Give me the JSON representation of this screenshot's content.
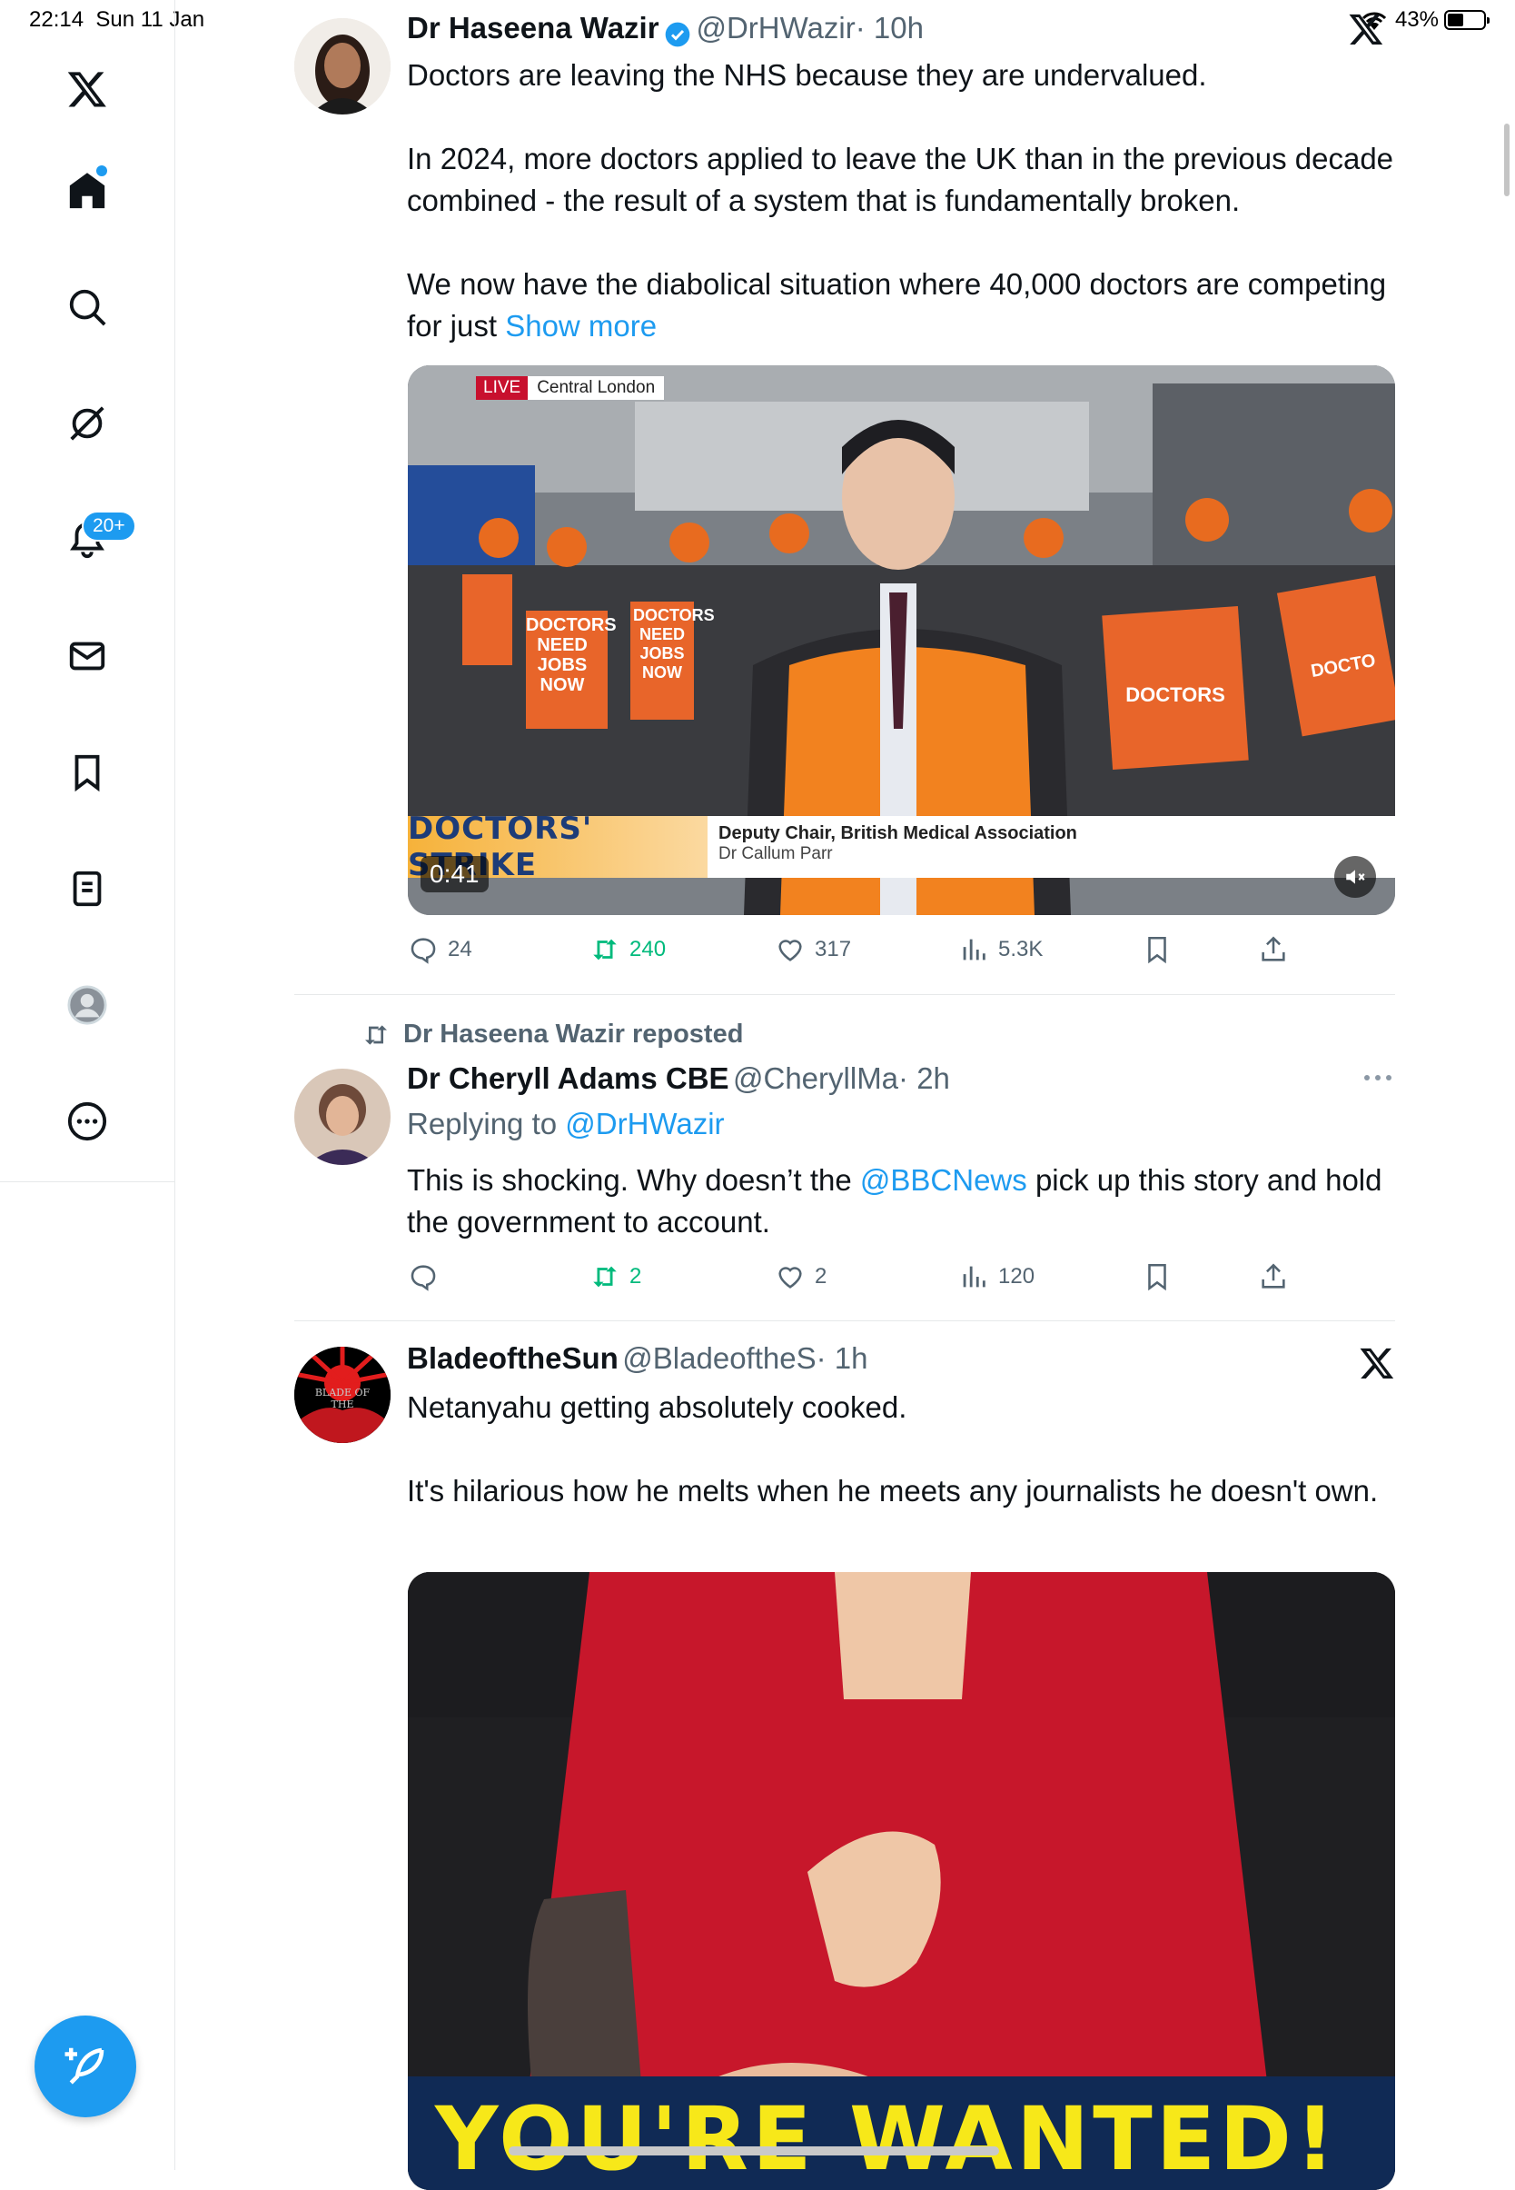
{
  "status_bar": {
    "time": "22:14",
    "date": "Sun 11 Jan",
    "battery": "43%"
  },
  "sidebar": {
    "notifications_badge": "20+",
    "items": [
      "x-logo",
      "home",
      "search",
      "grok",
      "notifications",
      "messages",
      "bookmarks",
      "lists",
      "profile",
      "more"
    ]
  },
  "tweet1": {
    "name": "Dr Haseena Wazir",
    "handle": "@DrHWazir",
    "time": "· 10h",
    "p1": "Doctors are leaving the NHS because they are undervalued.",
    "p2": "In 2024, more doctors applied to leave the UK than in the previous decade combined - the result of a system that is fundamentally broken.",
    "p3": "We now have the diabolical situation where 40,000 doctors are competing for just",
    "show_more": "Show more",
    "video": {
      "live_label": "LIVE",
      "location": "Central London",
      "strap_title": "DOCTORS' STRIKE",
      "strap_role": "Deputy Chair, British Medical Association",
      "strap_name": "Dr Callum Parr",
      "duration": "0:41",
      "sign1": "DOCTORS NEED JOBS NOW",
      "sign2": "DOCTORS NEED JOBS NOW",
      "sign3": "DOCTORS",
      "sign4": "DOCTO"
    },
    "replies": "24",
    "reposts": "240",
    "likes": "317",
    "views": "5.3K"
  },
  "tweet2": {
    "repost_label": "Dr Haseena Wazir reposted",
    "name": "Dr Cheryll Adams CBE",
    "handle": "@CheryllMa",
    "time": "· 2h",
    "replying_prefix": "Replying to",
    "replying_to": "@DrHWazir",
    "text_before": "This is shocking. Why doesn’t the",
    "mention": "@BBCNews",
    "text_after": "pick up this story and hold the government to account.",
    "reposts": "2",
    "likes": "2",
    "views": "120"
  },
  "tweet3": {
    "name": "BladeoftheSun",
    "handle": "@BladeoftheS",
    "time": "· 1h",
    "avatar_text": "BLADE OF THE",
    "p1": "Netanyahu getting absolutely cooked.",
    "p2": "It's hilarious how he melts when he meets any journalists he doesn't own.",
    "video_caption": "YOU'RE WANTED!"
  },
  "colors": {
    "accent": "#1d9bf0",
    "repost_green": "#00ba7c",
    "muted": "#536471"
  }
}
